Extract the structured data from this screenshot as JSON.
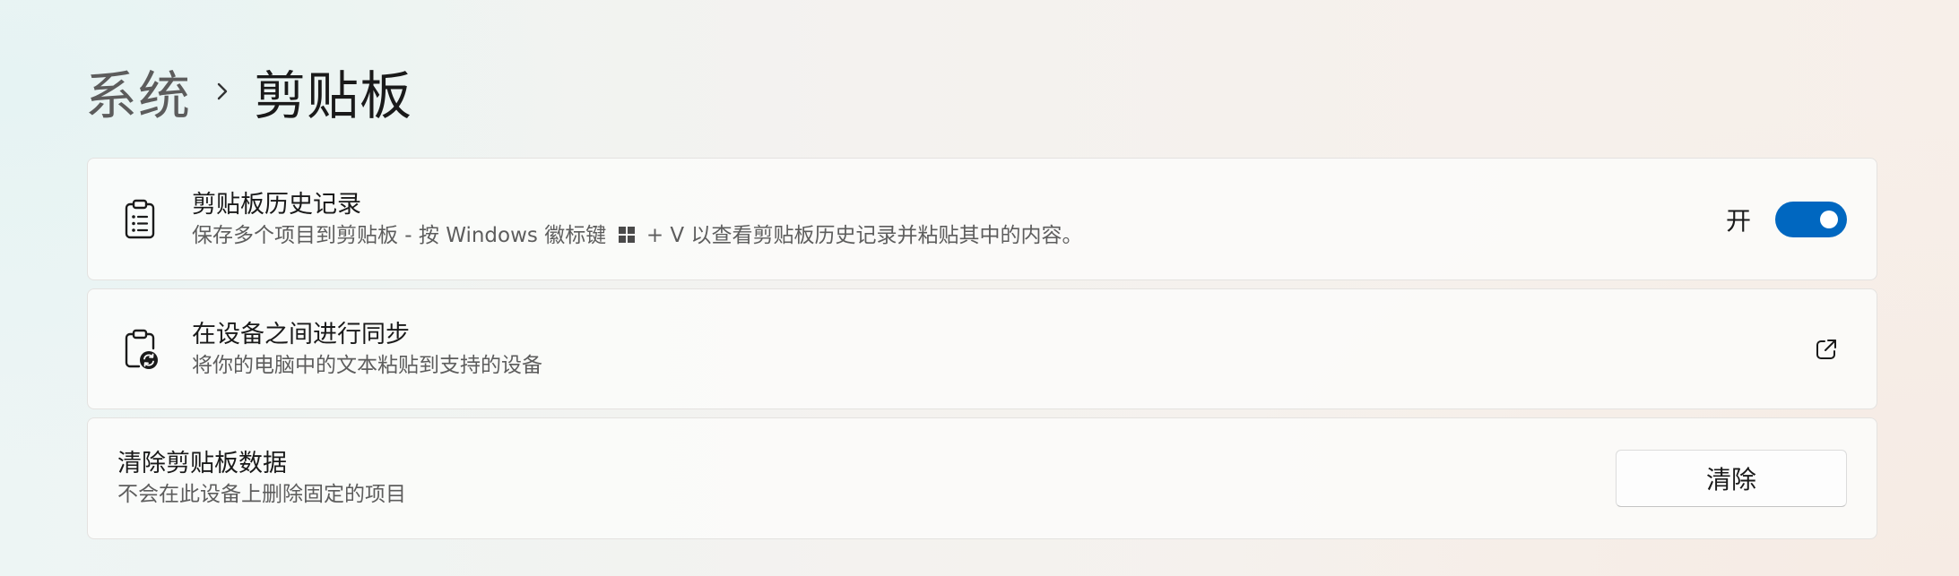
{
  "breadcrumb": {
    "parent": "系统",
    "current": "剪贴板"
  },
  "clipboard_history": {
    "title": "剪贴板历史记录",
    "description_before_icon": "保存多个项目到剪贴板 - 按 Windows 徽标键",
    "description_after_icon": "+ V 以查看剪贴板历史记录并粘贴其中的内容。",
    "icon": "clipboard-list-icon",
    "toggle_label": "开",
    "toggle_on": true,
    "accent_color": "#0067c0"
  },
  "sync_devices": {
    "title": "在设备之间进行同步",
    "description": "将你的电脑中的文本粘贴到支持的设备",
    "icon": "clipboard-sync-icon",
    "action_icon": "open-external-icon"
  },
  "clear_data": {
    "title": "清除剪贴板数据",
    "description": "不会在此设备上删除固定的项目",
    "button_label": "清除"
  }
}
